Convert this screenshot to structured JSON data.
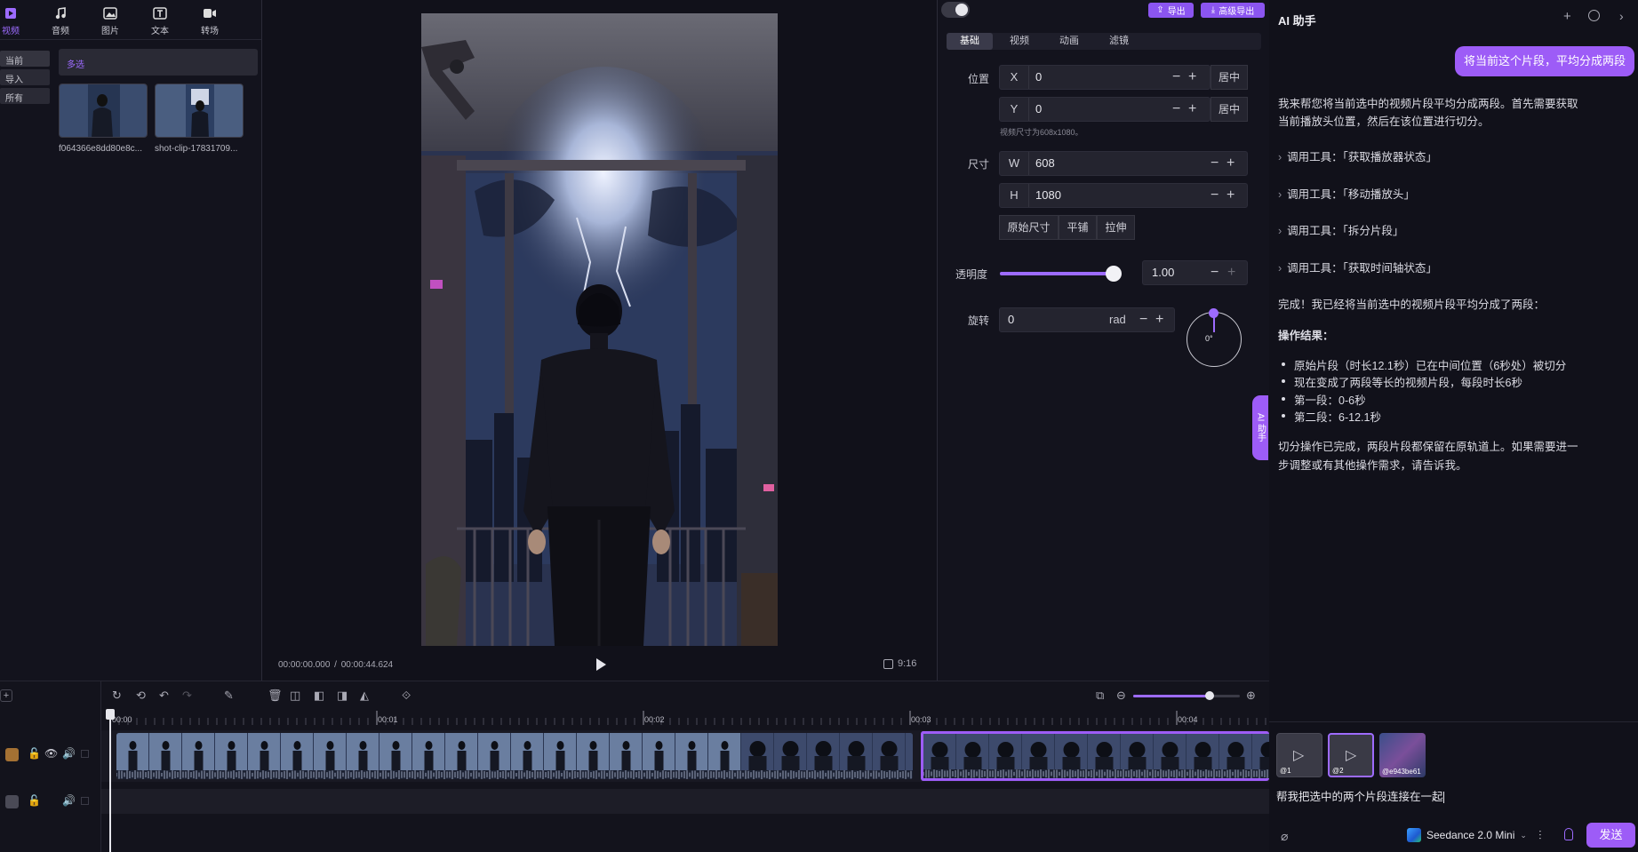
{
  "media_tabs": [
    {
      "label": "视频",
      "icon": "video-icon",
      "active": true
    },
    {
      "label": "音频",
      "icon": "music-icon",
      "active": false
    },
    {
      "label": "图片",
      "icon": "image-icon",
      "active": false
    },
    {
      "label": "文本",
      "icon": "text-icon",
      "active": false
    },
    {
      "label": "转场",
      "icon": "transition-icon",
      "active": false
    }
  ],
  "media_filters": [
    "当前",
    "导入",
    "所有"
  ],
  "multi_select_label": "多选",
  "media_items": [
    {
      "name": "f064366e8dd80e8c..."
    },
    {
      "name": "shot-clip-17831709..."
    }
  ],
  "preview": {
    "time_current": "00:00:00.000",
    "time_separator": "/",
    "time_total": "00:00:44.624",
    "aspect": "9:16"
  },
  "props": {
    "export_label": "导出",
    "advanced_export_label": "高级导出",
    "tabs": [
      "基础",
      "视频",
      "动画",
      "滤镜"
    ],
    "position_label": "位置",
    "x_axis": "X",
    "x_value": "0",
    "y_axis": "Y",
    "y_value": "0",
    "center_label": "居中",
    "size_hint": "视频尺寸为608x1080。",
    "size_label": "尺寸",
    "w_axis": "W",
    "w_value": "608",
    "h_axis": "H",
    "h_value": "1080",
    "size_buttons": [
      "原始尺寸",
      "平铺",
      "拉伸"
    ],
    "opacity_label": "透明度",
    "opacity_value": "1.00",
    "opacity_fraction": 1.0,
    "rotation_label": "旋转",
    "rotation_value": "0",
    "rotation_unit": "rad",
    "dial_value": "0°"
  },
  "ai": {
    "title": "AI 助手",
    "user_message": "将当前这个片段，平均分成两段",
    "reply_intro_1": "我来帮您将当前选中的视频片段平均分成两段。首先需要获取",
    "reply_intro_2": "当前播放头位置，然后在该位置进行切分。",
    "tool_calls": [
      "调用工具：「获取播放器状态」",
      "调用工具：「移动播放头」",
      "调用工具：「拆分片段」",
      "调用工具：「获取时间轴状态」"
    ],
    "done_text": "完成！我已经将当前选中的视频片段平均分成了两段：",
    "result_heading": "操作结果：",
    "result_items": [
      "原始片段（时长12.1秒）已在中间位置（6秒处）被切分",
      "现在变成了两段等长的视频片段，每段时长6秒",
      "第一段：0-6秒",
      "第二段：6-12.1秒"
    ],
    "closing_1": "切分操作已完成，两段片段都保留在原轨道上。如果需要进一",
    "closing_2": "步调整或有其他操作需求，请告诉我。",
    "side_tab": "AI 助手",
    "attachments": [
      "@1",
      "@2",
      "@e943be61"
    ],
    "input_value": "帮我把选中的两个片段连接在一起",
    "model_name": "Seedance 2.0 Mini",
    "send_label": "发送"
  },
  "timeline": {
    "ticks": [
      "00:00",
      "00:01",
      "00:02",
      "00:03",
      "00:04"
    ],
    "zoom_fraction": 0.72
  },
  "colors": {
    "accent": "#9d6bff",
    "bg": "#11111b",
    "panel": "#151520"
  }
}
